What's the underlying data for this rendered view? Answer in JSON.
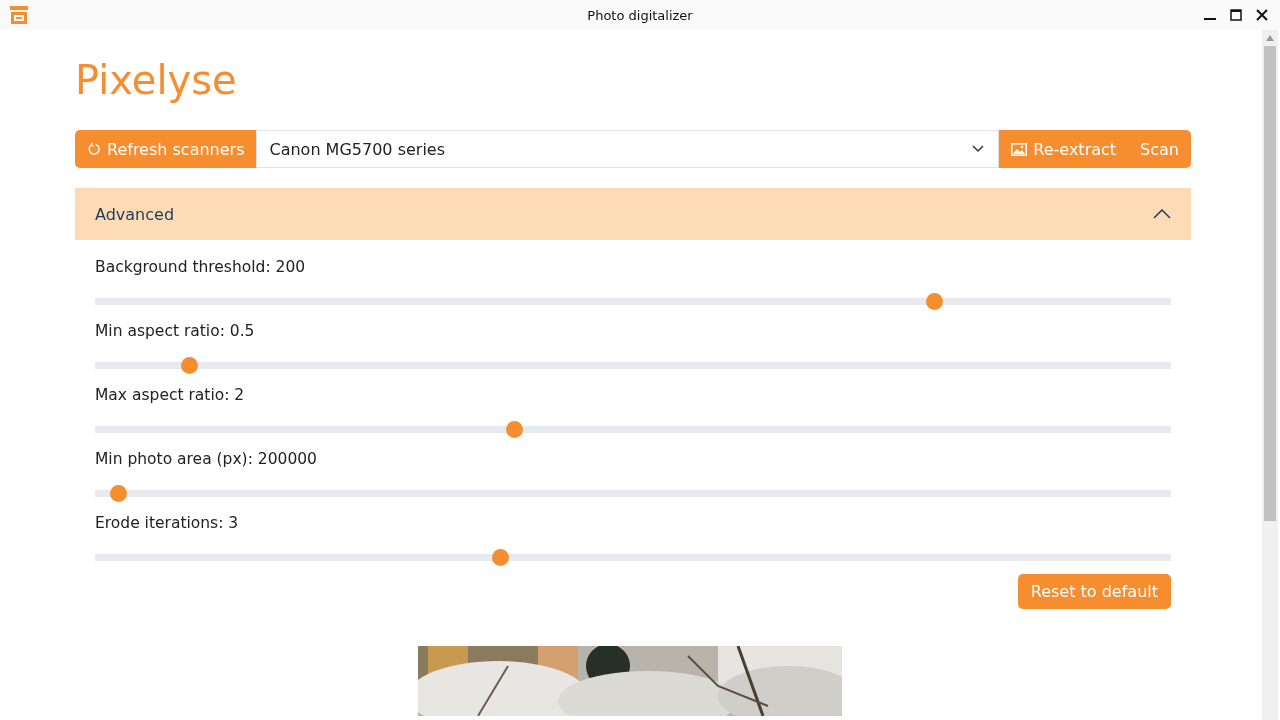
{
  "window": {
    "title": "Photo digitalizer"
  },
  "logo": "Pixelyse",
  "toolbar": {
    "refresh_button": "Refresh scanners",
    "scanner": "Canon MG5700 series",
    "reextract_button": "Re-extract",
    "scan_button": "Scan"
  },
  "advanced": {
    "title": "Advanced",
    "expanded": true,
    "sliders": [
      {
        "label": "Background threshold: 200",
        "level": 0.78
      },
      {
        "label": "Min aspect ratio: 0.5",
        "level": 0.087
      },
      {
        "label": "Max aspect ratio: 2",
        "level": 0.389
      },
      {
        "label": "Min photo area (px): 200000",
        "level": 0.021
      },
      {
        "label": "Erode iterations: 3",
        "level": 0.376
      }
    ],
    "reset_button": "Reset to default"
  }
}
